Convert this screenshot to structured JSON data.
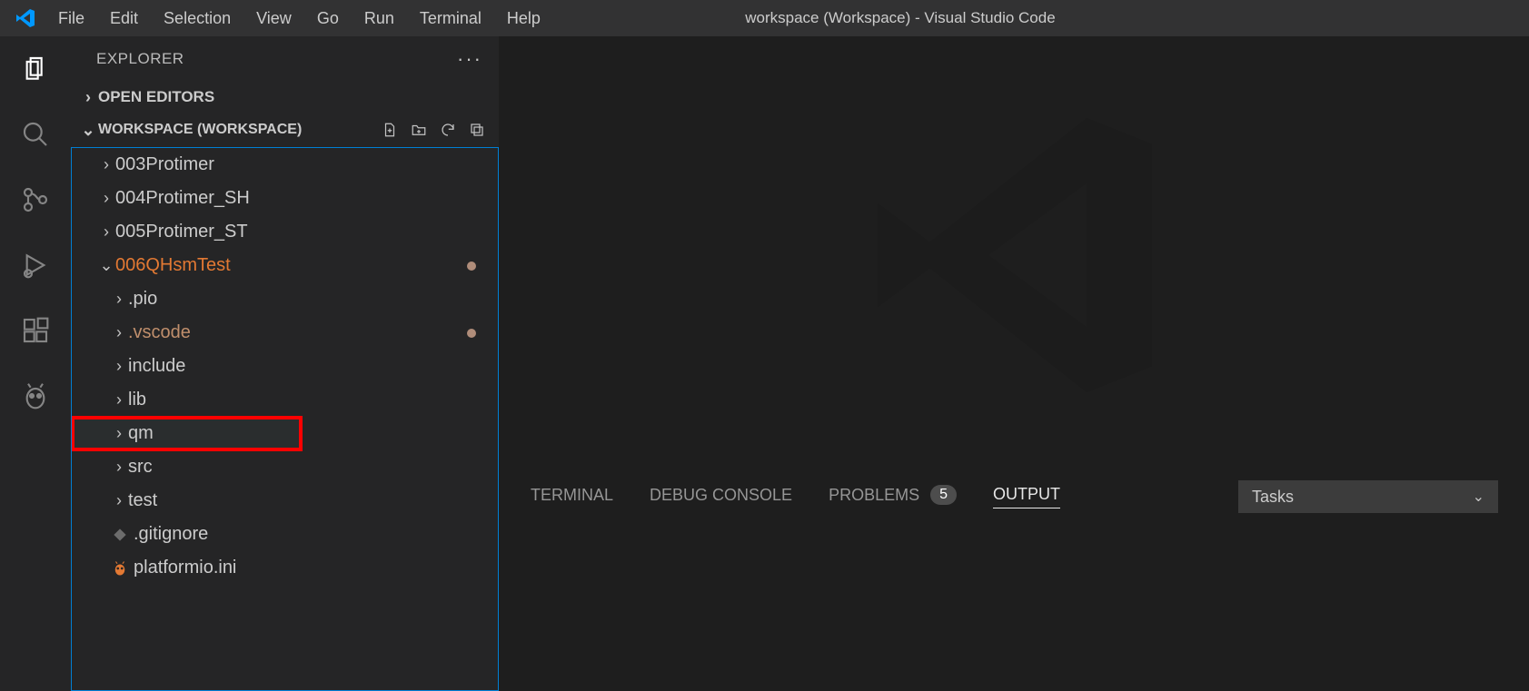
{
  "titlebar": {
    "menu": [
      "File",
      "Edit",
      "Selection",
      "View",
      "Go",
      "Run",
      "Terminal",
      "Help"
    ],
    "title": "workspace (Workspace) - Visual Studio Code"
  },
  "activitybar": {
    "items": [
      "explorer",
      "search",
      "scm",
      "run-debug",
      "extensions",
      "platformio"
    ]
  },
  "sidebar": {
    "title": "EXPLORER",
    "sections": {
      "open_editors": "OPEN EDITORS",
      "workspace_label": "WORKSPACE (WORKSPACE)"
    },
    "tree": [
      {
        "name": "003Protimer",
        "type": "folder",
        "depth": 0
      },
      {
        "name": "004Protimer_SH",
        "type": "folder",
        "depth": 0
      },
      {
        "name": "005Protimer_ST",
        "type": "folder",
        "depth": 0
      },
      {
        "name": "006QHsmTest",
        "type": "folder",
        "depth": 0,
        "expanded": true,
        "active": true,
        "git_dot": true
      },
      {
        "name": ".pio",
        "type": "folder",
        "depth": 1
      },
      {
        "name": ".vscode",
        "type": "folder",
        "depth": 1,
        "git_modified": true,
        "git_dot": true
      },
      {
        "name": "include",
        "type": "folder",
        "depth": 1
      },
      {
        "name": "lib",
        "type": "folder",
        "depth": 1
      },
      {
        "name": "qm",
        "type": "folder",
        "depth": 1,
        "highlighted": true
      },
      {
        "name": "src",
        "type": "folder",
        "depth": 1
      },
      {
        "name": "test",
        "type": "folder",
        "depth": 1
      },
      {
        "name": ".gitignore",
        "type": "file",
        "depth": 1,
        "icon": "git"
      },
      {
        "name": "platformio.ini",
        "type": "file",
        "depth": 1,
        "icon": "pio"
      }
    ]
  },
  "panel": {
    "tabs": {
      "terminal": "TERMINAL",
      "debug_console": "DEBUG CONSOLE",
      "problems": "PROBLEMS",
      "problems_count": "5",
      "output": "OUTPUT"
    },
    "dropdown": "Tasks"
  }
}
